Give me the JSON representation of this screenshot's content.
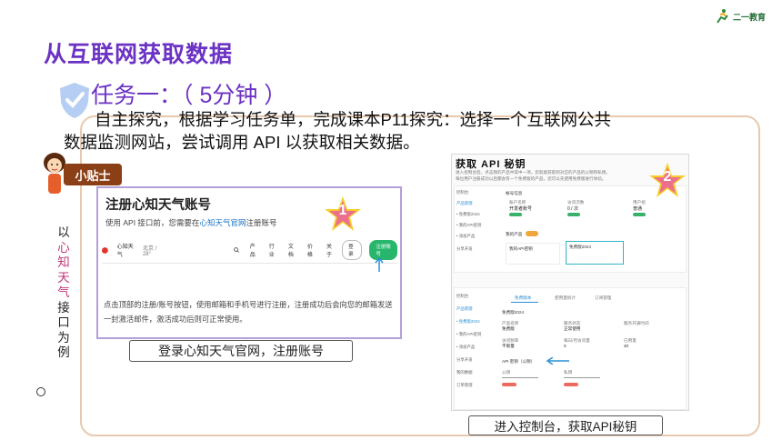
{
  "logo": {
    "text": "二一教育"
  },
  "slide": {
    "title": "从互联网获取数据",
    "task_title": "任务一：（ 5分钟 ）",
    "task_desc_line1": "自主探究，根据学习任务单，完成课本P11探究：选择一个互联网公共",
    "task_desc_line2": "数据监测网站，尝试调用 API 以获取相关数据。",
    "tip_label": "小贴士",
    "side_note": [
      "以",
      "心",
      "知",
      "天",
      "气",
      "接",
      "口",
      "为",
      "例"
    ],
    "side_note_highlight": [
      1,
      2,
      3,
      4
    ]
  },
  "shot1": {
    "title": "注册心知天气账号",
    "sub_prefix": "使用 API 接口前，您需要在",
    "sub_link": "心知天气官网",
    "sub_suffix": "注册账号",
    "nav": {
      "brand": "心知天气",
      "city": "北京 / 28°",
      "items": [
        "产品",
        "行业",
        "文档",
        "价格",
        "关于"
      ],
      "login": "登录",
      "register": "注册账号"
    },
    "desc": "点击顶部的注册/账号按钮，使用邮箱和手机号进行注册，注册成功后会向您的邮箱发送一封激活邮件，激活成功后则可正常使用。",
    "step": "1",
    "caption": "登录心知天气官网，注册账号"
  },
  "shot2": {
    "title": "获取 API 秘钥",
    "intro1": "进入控制台后，点击我的产品中其中一项，您就能获取到对应的产品的公钥和私钥。",
    "intro2": "每位用户注册成功以后都会有一个免费版的产品，您可以先使用免费版进行体验。",
    "side_items": [
      "控制台",
      "产品管理",
      "• 免费版2024",
      "• 我的API密钥",
      "• 添加产品",
      "分享开发"
    ],
    "section1": "帐号信息",
    "acct_labels": [
      "账户名称",
      "访问次数",
      "用户组"
    ],
    "acct_values": [
      "开发者账号",
      "0 / 次",
      "普通"
    ],
    "section2": "我的产品",
    "product1": "我的API密钥",
    "product2": "免费版2024",
    "side_items2": [
      "控制台",
      "产品管理",
      "• 免费版2024",
      "• 我的API密钥",
      "• 添加产品",
      "分享开发",
      "我的数据",
      "订单管理"
    ],
    "tabs": [
      "免费版本",
      "使用量统计",
      "订阅管理"
    ],
    "detail_title": "免费版2024",
    "detail_labels": [
      "产品名称",
      "服务状态",
      "服务开通时间",
      "访问频率",
      "每日/月访问量",
      "已用量"
    ],
    "detail_values": [
      "免费版",
      "正常使用",
      "",
      "不限量",
      "0",
      "20"
    ],
    "api_key_label": "API 密钥（公钥）",
    "public_key": "公钥",
    "private_key": "私钥",
    "step": "2",
    "caption": "进入控制台，获取API秘钥"
  },
  "colors": {
    "title_purple": "#6b32c4",
    "frame_border": "#e8c9ae",
    "tip_brown": "#8a3f16",
    "highlight_pink": "#c0387b",
    "star_pink": "#ec6f8c",
    "star_yellow": "#f7cf2a",
    "green": "#27b66b"
  }
}
